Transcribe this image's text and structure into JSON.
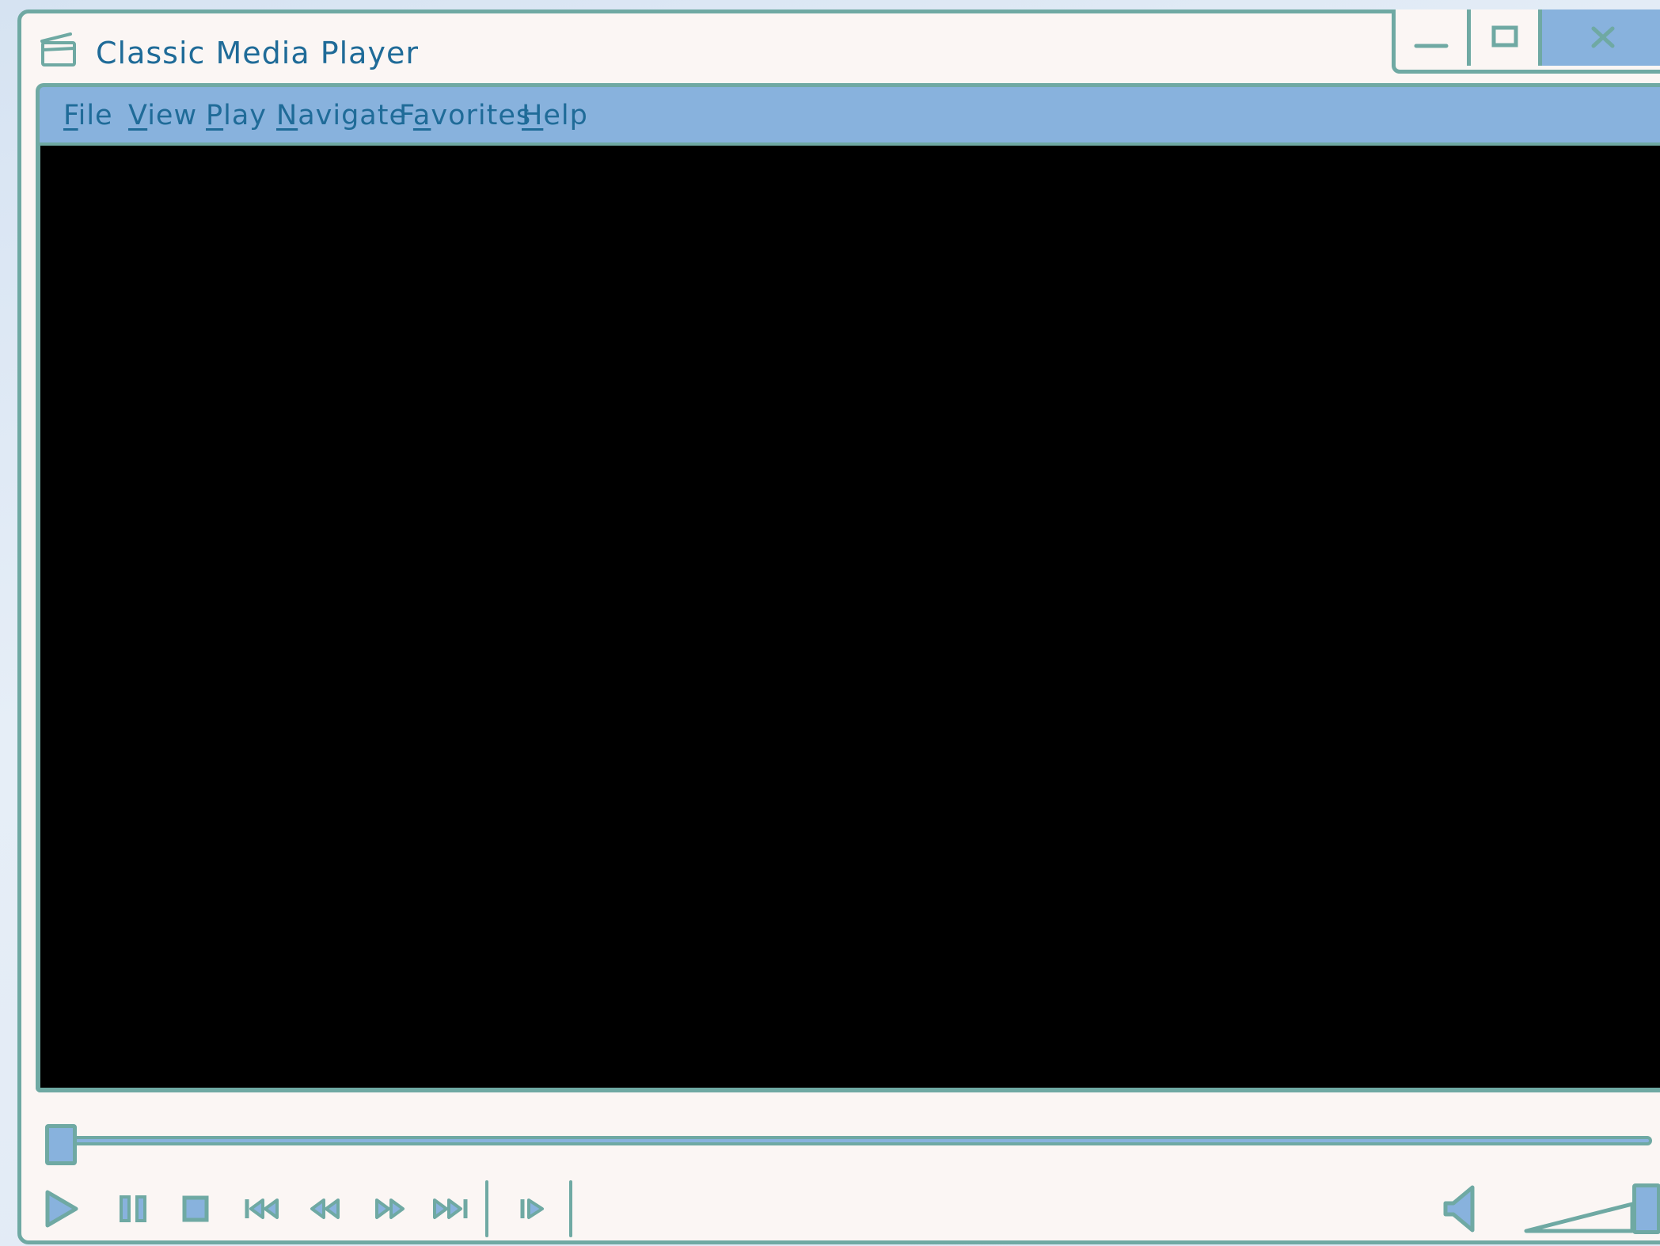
{
  "window": {
    "title": "Classic Media Player"
  },
  "title_controls": {
    "minimize_icon": "minimize-icon",
    "maximize_icon": "maximize-icon",
    "close_icon": "close-icon"
  },
  "menu": {
    "items": [
      {
        "label": "File",
        "underline": "F",
        "rest": "ile"
      },
      {
        "label": "View",
        "underline": "V",
        "rest": "iew"
      },
      {
        "label": "Play",
        "underline": "P",
        "rest": "lay"
      },
      {
        "label": "Navigate",
        "underline": "N",
        "rest": "avigate"
      },
      {
        "label": "Favorites",
        "pre": "F",
        "underline": "a",
        "rest": "vorites"
      },
      {
        "label": "Help",
        "underline": "H",
        "rest": "elp"
      }
    ]
  },
  "playback": {
    "seek_position_fraction": 0.0,
    "volume_fraction": 1.0
  },
  "colors": {
    "accent": "#88b2dd",
    "border": "#6fa9a3",
    "text": "#1f6b98",
    "window_bg": "#fbf6f4",
    "video_bg": "#000000"
  },
  "icons": {
    "app": "clapperboard-icon",
    "play": "play-icon",
    "pause": "pause-icon",
    "stop": "stop-icon",
    "prev": "skip-back-icon",
    "rewind": "rewind-icon",
    "forward": "fast-forward-icon",
    "next": "skip-forward-icon",
    "step": "frame-step-icon",
    "volume": "speaker-icon"
  }
}
